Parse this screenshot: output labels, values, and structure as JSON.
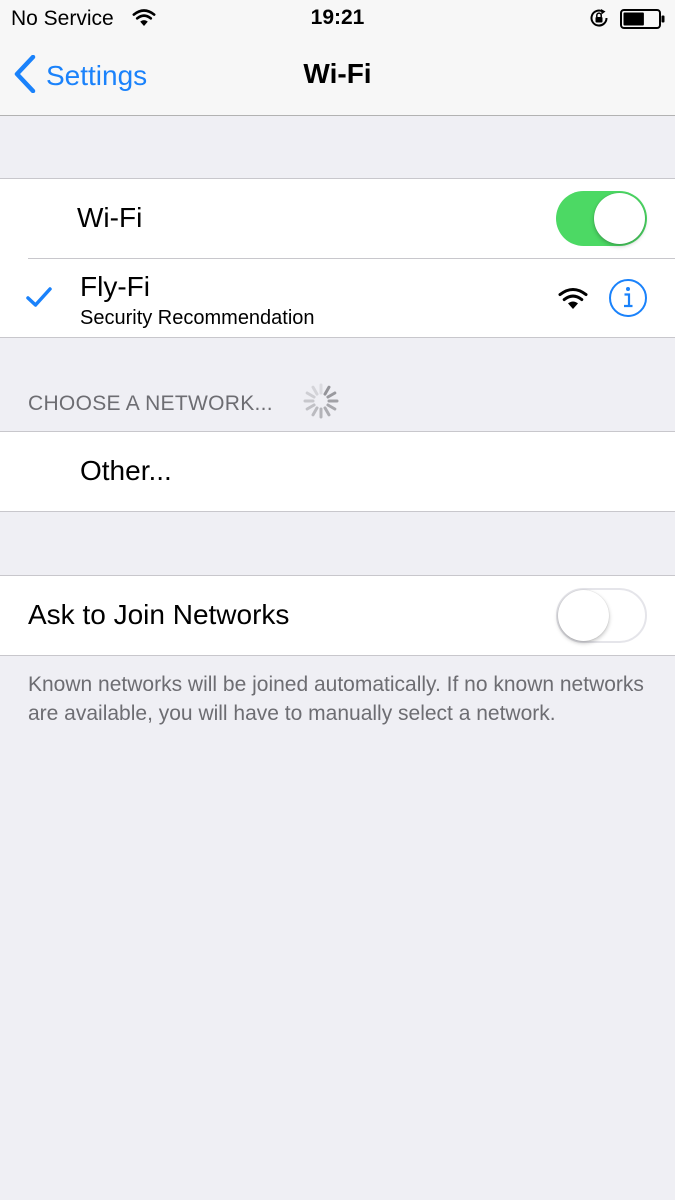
{
  "status_bar": {
    "carrier": "No Service",
    "time": "19:21",
    "icons": [
      "wifi-icon",
      "orientation-lock-icon",
      "battery-icon"
    ],
    "battery_level": 0.6
  },
  "nav": {
    "back_label": "Settings",
    "title": "Wi-Fi"
  },
  "wifi_toggle": {
    "label": "Wi-Fi",
    "on": true
  },
  "connected_network": {
    "name": "Fly-Fi",
    "subtitle": "Security Recommendation",
    "icons": [
      "checkmark-icon",
      "wifi-signal-icon",
      "info-icon"
    ]
  },
  "choose_network": {
    "header": "CHOOSE A NETWORK...",
    "other_label": "Other..."
  },
  "ask_to_join": {
    "label": "Ask to Join Networks",
    "on": false,
    "footer": "Known networks will be joined automatically. If no known networks are available, you will have to manually select a network."
  },
  "colors": {
    "accent": "#1a82fb",
    "toggle_on": "#4cd964",
    "background": "#efeff4",
    "secondary_text": "#6d6d72"
  }
}
